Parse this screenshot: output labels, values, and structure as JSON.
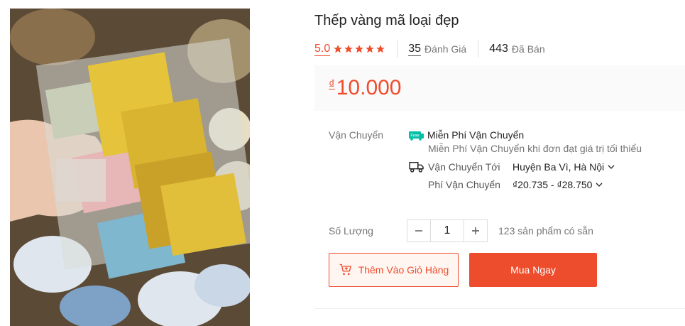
{
  "product": {
    "title": "Thếp vàng mã loại đẹp",
    "image_alt": "Thếp vàng mã"
  },
  "rating": {
    "score": "5.0",
    "stars": 5,
    "reviews_count": "35",
    "reviews_label": "Đánh Giá",
    "sold_count": "443",
    "sold_label": "Đã Bán"
  },
  "price": {
    "currency": "₫",
    "value": "10.000"
  },
  "shipping": {
    "label": "Vận Chuyển",
    "free_badge": "Free",
    "free_title": "Miễn Phí Vận Chuyển",
    "free_subtitle": "Miễn Phí Vận Chuyển khi đơn đạt giá trị tối thiểu",
    "to_label": "Vận Chuyển Tới",
    "to_value": "Huyện Ba Vì, Hà Nội",
    "fee_label": "Phí Vận Chuyển",
    "fee_value": "₫20.735 - ₫28.750"
  },
  "quantity": {
    "label": "Số Lượng",
    "value": "1",
    "stock_text": "123 sản phẩm có sẵn"
  },
  "actions": {
    "add_to_cart": "Thêm Vào Giỏ Hàng",
    "buy_now": "Mua Ngay"
  },
  "colors": {
    "accent": "#ee4d2d",
    "free_badge": "#00bfa5"
  }
}
